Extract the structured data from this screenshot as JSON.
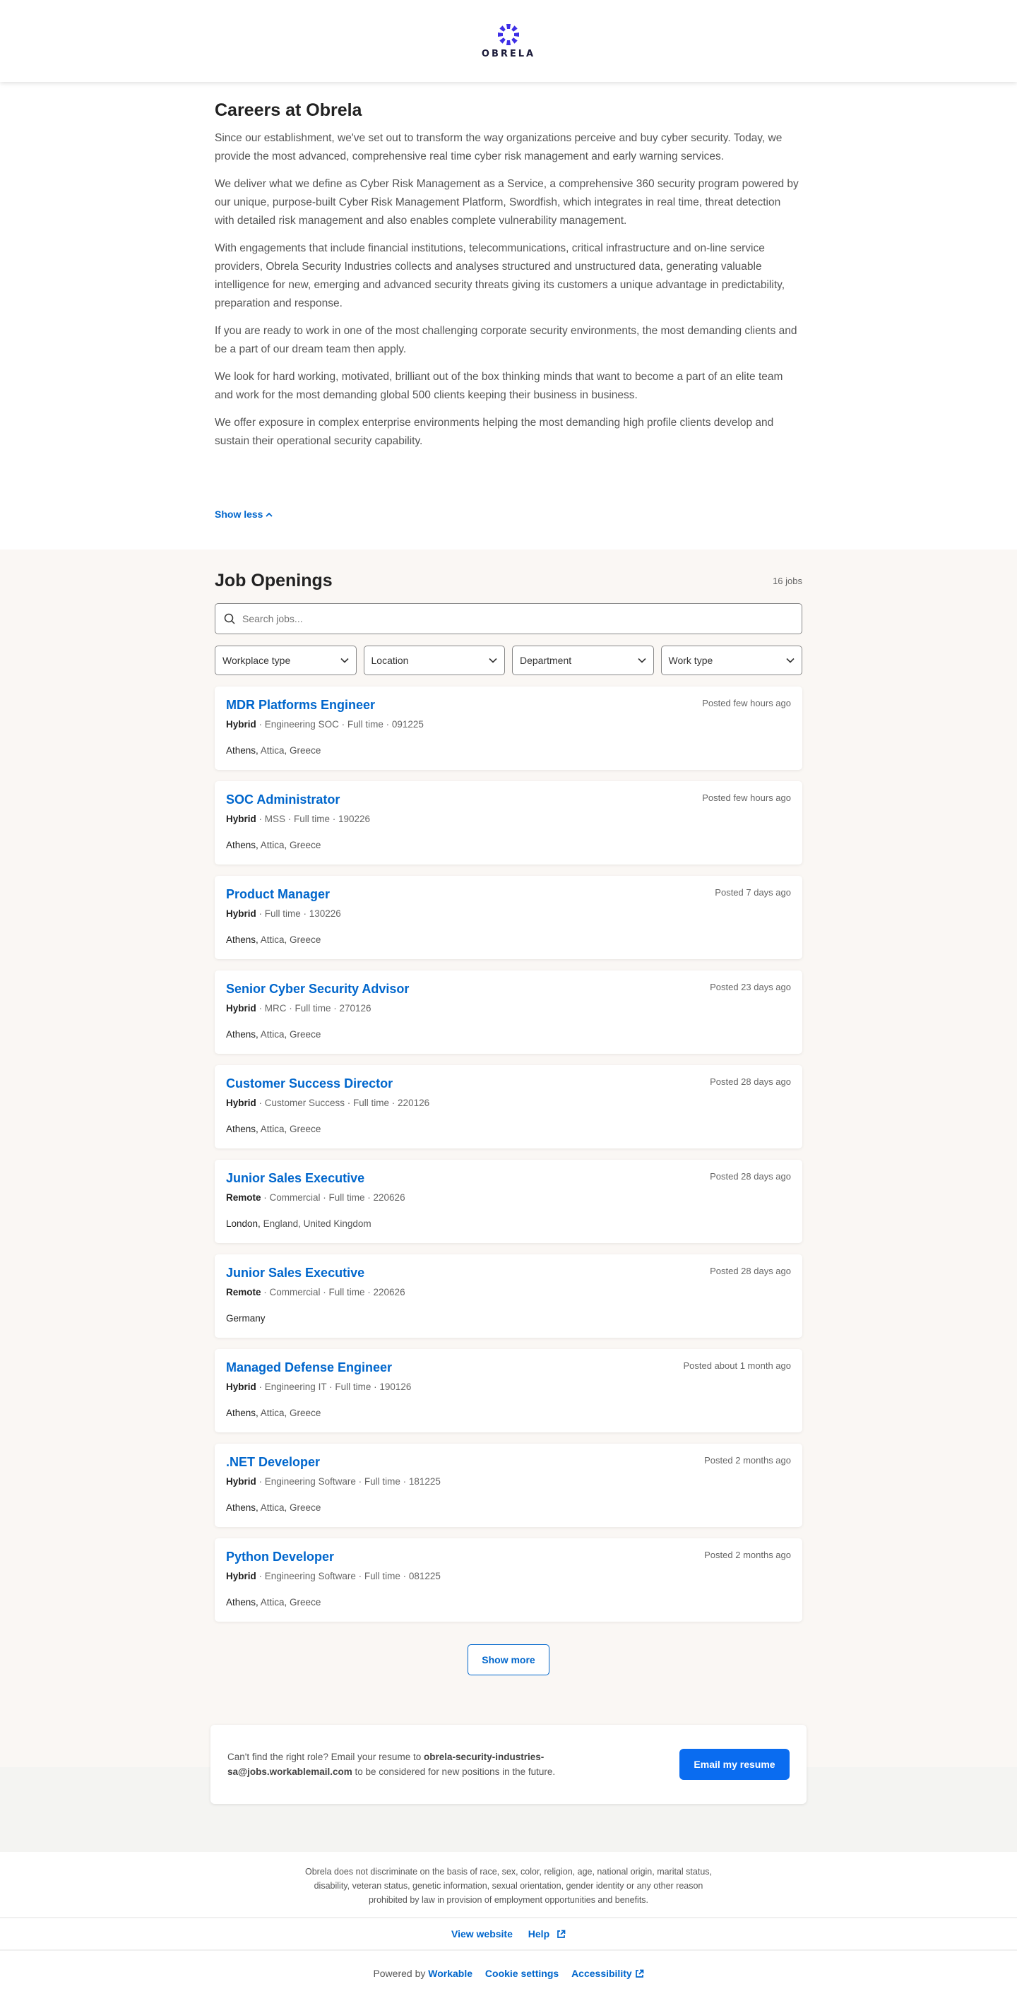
{
  "header": {
    "logo_text": "OBRELA"
  },
  "intro": {
    "title": "Careers at Obrela",
    "paragraphs": [
      "Since our establishment, we've set out to transform the way organizations perceive and buy cyber security. Today, we provide the most advanced, comprehensive real time cyber risk management and early warning services.",
      "We deliver what we define as Cyber Risk Management as a Service, a comprehensive 360 security program powered by our unique, purpose-built Cyber Risk Management Platform, Swordfish, which integrates in real time, threat detection with detailed risk management and also enables complete vulnerability management.",
      "With engagements that include financial institutions, telecommunications, critical infrastructure and on-line service providers, Obrela Security Industries collects and analyses structured and unstructured data, generating valuable intelligence for new, emerging and advanced security threats giving its customers a unique advantage in predictability, preparation and response.",
      "If you are ready to work in one of the most challenging corporate security environments, the most demanding clients and be a part of our dream team then apply.",
      "We look for hard working, motivated, brilliant out of the box thinking minds that want to become a part of an elite team and work for the most demanding global 500 clients keeping their business in business.",
      "We offer exposure in complex enterprise environments helping the most demanding high profile clients develop and sustain their operational security capability."
    ],
    "show_less": "Show less"
  },
  "jobs": {
    "title": "Job Openings",
    "count": "16 jobs",
    "search_placeholder": "Search jobs...",
    "filters": [
      "Workplace type",
      "Location",
      "Department",
      "Work type"
    ],
    "list": [
      {
        "title": "MDR Platforms Engineer",
        "posted": "Posted few hours ago",
        "workplace": "Hybrid",
        "details": " · Engineering SOC · Full time · 091225",
        "city": "Athens,",
        "region": " Attica, Greece"
      },
      {
        "title": "SOC Administrator",
        "posted": "Posted few hours ago",
        "workplace": "Hybrid",
        "details": " · MSS · Full time · 190226",
        "city": "Athens,",
        "region": " Attica, Greece"
      },
      {
        "title": "Product Manager",
        "posted": "Posted 7 days ago",
        "workplace": "Hybrid",
        "details": " · Full time · 130226",
        "city": "Athens,",
        "region": " Attica, Greece"
      },
      {
        "title": "Senior Cyber Security Advisor",
        "posted": "Posted 23 days ago",
        "workplace": "Hybrid",
        "details": " · MRC · Full time · 270126",
        "city": "Athens,",
        "region": " Attica, Greece"
      },
      {
        "title": "Customer Success Director",
        "posted": "Posted 28 days ago",
        "workplace": "Hybrid",
        "details": " · Customer Success · Full time · 220126",
        "city": "Athens,",
        "region": " Attica, Greece"
      },
      {
        "title": "Junior Sales Executive",
        "posted": "Posted 28 days ago",
        "workplace": "Remote",
        "details": " · Commercial · Full time · 220626",
        "city": "London,",
        "region": " England, United Kingdom"
      },
      {
        "title": "Junior Sales Executive",
        "posted": "Posted 28 days ago",
        "workplace": "Remote",
        "details": " · Commercial · Full time · 220626",
        "city": "Germany",
        "region": ""
      },
      {
        "title": "Managed Defense Engineer",
        "posted": "Posted about 1 month ago",
        "workplace": "Hybrid",
        "details": " · Engineering IT · Full time · 190126",
        "city": "Athens,",
        "region": " Attica, Greece"
      },
      {
        "title": ".NET Developer",
        "posted": "Posted 2 months ago",
        "workplace": "Hybrid",
        "details": " · Engineering Software · Full time · 181225",
        "city": "Athens,",
        "region": " Attica, Greece"
      },
      {
        "title": "Python Developer",
        "posted": "Posted 2 months ago",
        "workplace": "Hybrid",
        "details": " · Engineering Software · Full time · 081225",
        "city": "Athens,",
        "region": " Attica, Greece"
      }
    ],
    "show_more": "Show more"
  },
  "resume": {
    "text_before": "Can't find the right role? Email your resume to ",
    "email": "obrela-security-industries-sa@jobs.workablemail.com",
    "text_after": " to be considered for new positions in the future.",
    "button": "Email my resume"
  },
  "footer": {
    "legal": "Obrela does not discriminate on the basis of race, sex, color, religion, age, national origin, marital status, disability, veteran status, genetic information, sexual orientation, gender identity or any other reason prohibited by law in provision of employment opportunities and benefits.",
    "view_website": "View website",
    "help": "Help",
    "powered_by": "Powered by ",
    "workable": "Workable",
    "cookie_settings": "Cookie settings",
    "accessibility": "Accessibility"
  },
  "colors": {
    "accent": "#0066cc",
    "button": "#0a6cf0",
    "logo": "#3d2ee6"
  }
}
